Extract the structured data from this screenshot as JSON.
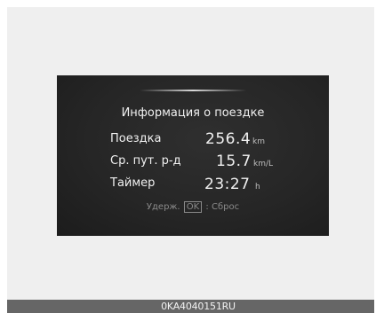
{
  "display": {
    "title": "Информация о поездке",
    "rows": [
      {
        "label": "Поездка",
        "value": "256.4",
        "unit": "km"
      },
      {
        "label": "Ср. пут. р-д",
        "value": "15.7",
        "unit": "km/L"
      },
      {
        "label": "Таймер",
        "value": "23:27",
        "unit": "h"
      }
    ],
    "hint": {
      "prefix": "Удерж.",
      "key": "OK",
      "suffix": ": Сброс"
    }
  },
  "caption": {
    "image_code": "0KA4040151RU"
  },
  "colors": {
    "screen_background": "#262626",
    "text": "#f0f0f0",
    "hint_text": "#8a8a8a",
    "caption_bar": "#666666",
    "frame_background": "#efefef"
  }
}
